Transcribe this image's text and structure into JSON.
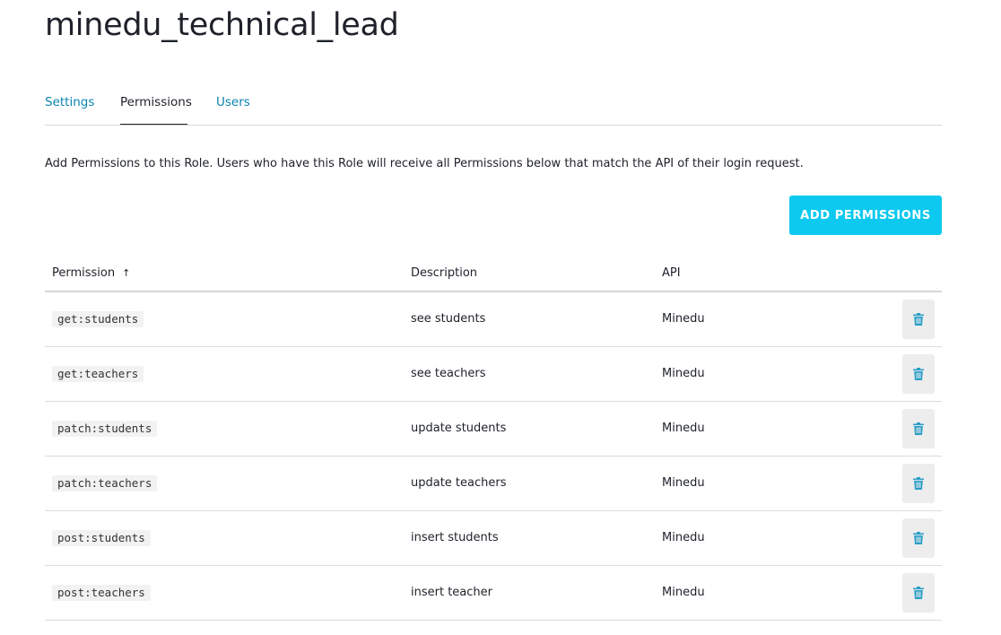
{
  "role": {
    "title": "minedu_technical_lead"
  },
  "tabs": [
    {
      "label": "Settings"
    },
    {
      "label": "Permissions"
    },
    {
      "label": "Users"
    }
  ],
  "active_tab": "Permissions",
  "intro_text": "Add Permissions to this Role. Users who have this Role will receive all Permissions below that match the API of their login request.",
  "add_button_label": "ADD PERMISSIONS",
  "table": {
    "columns": {
      "permission": "Permission",
      "description": "Description",
      "api": "API"
    },
    "sort": {
      "column": "Permission",
      "direction": "ascending",
      "indicator": "↑"
    },
    "rows": [
      {
        "permission": "get:students",
        "description": "see students",
        "api": "Minedu"
      },
      {
        "permission": "get:teachers",
        "description": "see teachers",
        "api": "Minedu"
      },
      {
        "permission": "patch:students",
        "description": "update students",
        "api": "Minedu"
      },
      {
        "permission": "patch:teachers",
        "description": "update teachers",
        "api": "Minedu"
      },
      {
        "permission": "post:students",
        "description": "insert students",
        "api": "Minedu"
      },
      {
        "permission": "post:teachers",
        "description": "insert teacher",
        "api": "Minedu"
      }
    ]
  },
  "icons": {
    "delete": "trash-icon"
  },
  "colors": {
    "accent": "#0dc9f0",
    "link": "#0a84ae",
    "text": "#1e212a",
    "trash": "#2a9fc7",
    "code_bg": "#f2f2f2"
  }
}
